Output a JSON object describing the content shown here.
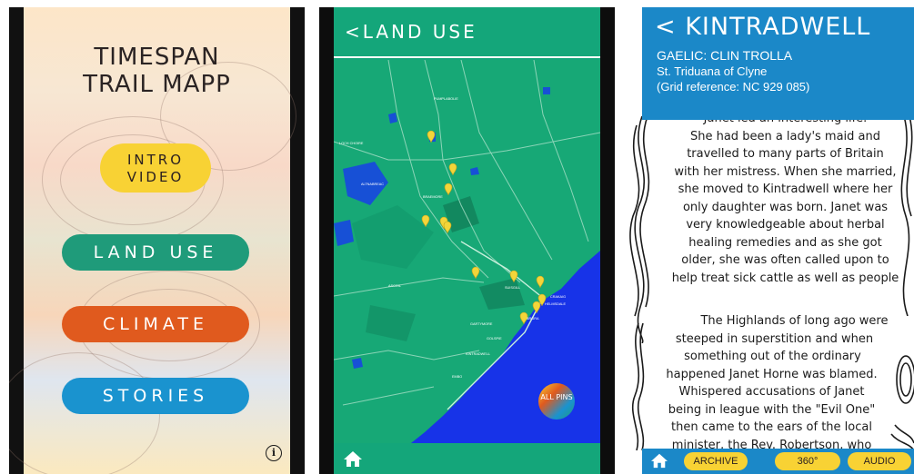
{
  "menu": {
    "title_line1": "TIMESPAN",
    "title_line2": "TRAIL MAPP",
    "intro_line1": "INTRO",
    "intro_line2": "VIDEO",
    "land_use": "LAND USE",
    "climate": "CLIMATE",
    "stories": "STORIES",
    "info_icon": "info-icon",
    "colors": {
      "intro": "#f8d234",
      "land_use": "#1f9b7a",
      "climate": "#e05a1e",
      "stories": "#1a93cf"
    }
  },
  "map_screen": {
    "title": "LAND USE",
    "back_icon": "chevron-left-icon",
    "home_icon": "home-icon",
    "all_pins": "ALL PINS",
    "accent": "#14a67a",
    "place_labels": [
      "PUMPLABOLIE",
      "ALTNABREAC",
      "BRAEMORE",
      "SUISGILL",
      "HELMSDALE",
      "BRORA",
      "GOLSPIE",
      "GARTYMORE",
      "KINTRADWELL",
      "EMBO",
      "LOCH CHOIRE",
      "ASCOIL",
      "CRAKAIG"
    ]
  },
  "story": {
    "title": "< KINTRADWELL",
    "gaelic": "GAELIC: CLIN TROLLA",
    "saint": "St. Triduana of Clyne",
    "grid": "(Grid reference: NC 929 085)",
    "para1_cut": "Janet led an interesting life.",
    "para1": [
      "She had been a lady's maid and",
      "travelled to many parts of Britain",
      "with her mistress. When she married,",
      "she moved to Kintradwell where her",
      "only daughter was born. Janet was",
      "very knowledgeable about herbal",
      "healing remedies and as she got",
      "older, she was often called upon to",
      "help treat sick cattle as well as people"
    ],
    "para2": [
      "The Highlands of long ago were",
      "steeped in superstition and when",
      "something out of the ordinary",
      "happened Janet Horne was blamed.",
      "Whispered accusations of Janet",
      "being in league with the \"Evil One\"",
      "then came to the ears of the local",
      "minister, the Rev. Robertson, who"
    ],
    "buttons": {
      "archive": "ARCHIVE",
      "view360": "360°",
      "audio": "AUDIO"
    },
    "home_icon": "home-icon",
    "accent": "#1b88c8"
  }
}
